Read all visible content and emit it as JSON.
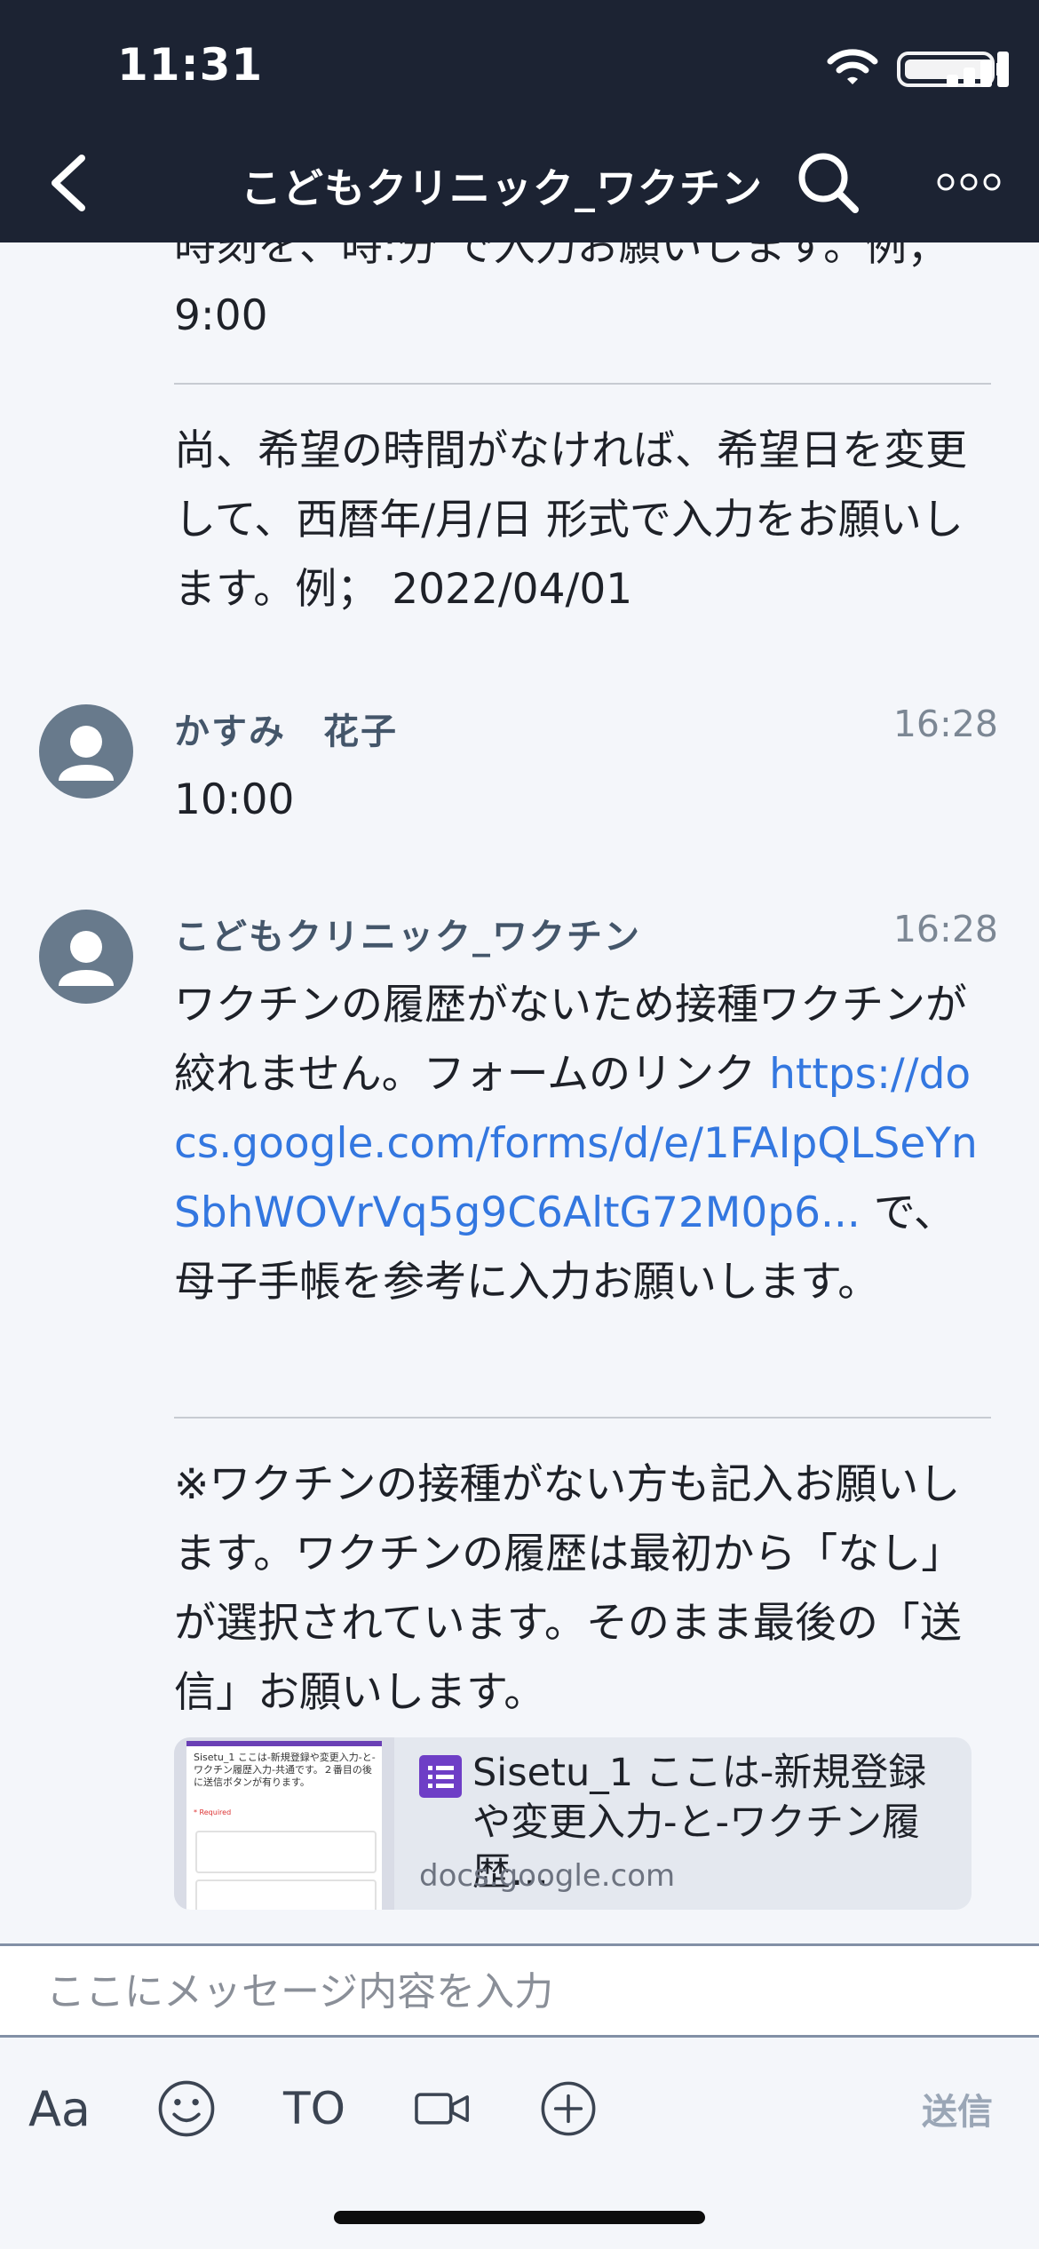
{
  "status_bar": {
    "time": "11:31"
  },
  "header": {
    "title": "こどもクリニック_ワクチン"
  },
  "messages": {
    "top_partial_line": "時刻を、時:分 で入力お願いします。例；",
    "top_line2": "9:00",
    "top_para2": "尚、希望の時間がなければ、希望日を変更して、西暦年/月/日 形式で入力をお願いします。例； 2022/04/01",
    "m2_sender": "かすみ　花子",
    "m2_time": "16:28",
    "m2_text": "10:00",
    "m3_sender": "こどもクリニック_ワクチン",
    "m3_time": "16:28",
    "m3_text_before": "ワクチンの履歴がないため接種ワクチンが絞れません。フォームのリンク ",
    "m3_link_text": "https://docs.google.com/forms/d/e/1FAIpQLSeYnSbhWOVrVq5g9C6AltG72M0p6...",
    "m3_text_after": " で、母子手帳を参考に入力お願いします。",
    "m3_para2": "※ワクチンの接種がない方も記入お願いします。ワクチンの履歴は最初から「なし」が選択されています。そのまま最後の「送信」お願いします。"
  },
  "link_card": {
    "title": "Sisetu_1 ここは-新規登録や変更入力-と-ワクチン履歴…",
    "domain": "docs.google.com",
    "thumb_heading": "Sisetu_1 ここは-新規登録や変更入力-と-ワクチン履歴入力-共通です。２番目の後に送信ボタンが有ります。",
    "thumb_required": "* Required"
  },
  "composer": {
    "placeholder": "ここにメッセージ内容を入力",
    "aa_label": "Aa",
    "to_label": "TO",
    "send_label": "送信"
  },
  "colors": {
    "header_bg": "#1c2333",
    "link": "#3377e0",
    "background": "#f4f6fa"
  }
}
